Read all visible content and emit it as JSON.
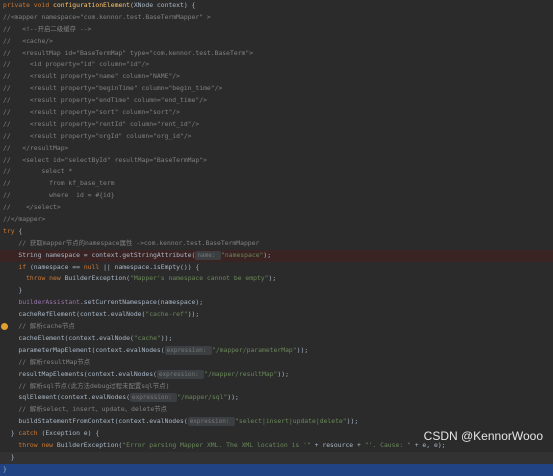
{
  "editor": {
    "lines": [
      {
        "kind": "plain",
        "segs": [
          {
            "t": "kw",
            "v": "private void "
          },
          {
            "t": "fn",
            "v": "configurationElement"
          },
          {
            "t": "plain",
            "v": "(XNode context) {"
          }
        ]
      },
      {
        "kind": "plain",
        "segs": [
          {
            "t": "cm",
            "v": "//<mapper namespace=\"com.kennor.test.BaseTermMapper\" >"
          }
        ]
      },
      {
        "kind": "plain",
        "segs": [
          {
            "t": "cm",
            "v": "//   <!--开启二级缓存 -->"
          }
        ]
      },
      {
        "kind": "plain",
        "segs": [
          {
            "t": "cm",
            "v": "//   <cache/>"
          }
        ]
      },
      {
        "kind": "plain",
        "segs": [
          {
            "t": "cm",
            "v": "//   <resultMap id=\"BaseTermMap\" type=\"com.kennor.test.BaseTerm\">"
          }
        ]
      },
      {
        "kind": "plain",
        "segs": [
          {
            "t": "cm",
            "v": "//     <id property=\"id\" column=\"id\"/>"
          }
        ]
      },
      {
        "kind": "plain",
        "segs": [
          {
            "t": "cm",
            "v": "//     <result property=\"name\" column=\"NAME\"/>"
          }
        ]
      },
      {
        "kind": "plain",
        "segs": [
          {
            "t": "cm",
            "v": "//     <result property=\"beginTime\" column=\"begin_time\"/>"
          }
        ]
      },
      {
        "kind": "plain",
        "segs": [
          {
            "t": "cm",
            "v": "//     <result property=\"endTime\" column=\"end_time\"/>"
          }
        ]
      },
      {
        "kind": "plain",
        "segs": [
          {
            "t": "cm",
            "v": "//     <result property=\"sort\" column=\"sort\"/>"
          }
        ]
      },
      {
        "kind": "plain",
        "segs": [
          {
            "t": "cm",
            "v": "//     <result property=\"rentId\" column=\"rent_id\"/>"
          }
        ]
      },
      {
        "kind": "plain",
        "segs": [
          {
            "t": "cm",
            "v": "//     <result property=\"orgId\" column=\"org_id\"/>"
          }
        ]
      },
      {
        "kind": "plain",
        "segs": [
          {
            "t": "cm",
            "v": "//   </resultMap>"
          }
        ]
      },
      {
        "kind": "plain",
        "segs": [
          {
            "t": "cm",
            "v": "//   <select id=\"selectById\" resultMap=\"BaseTermMap\">"
          }
        ]
      },
      {
        "kind": "plain",
        "segs": [
          {
            "t": "cm",
            "v": "//        select *"
          }
        ]
      },
      {
        "kind": "plain",
        "segs": [
          {
            "t": "cm",
            "v": "//          from kf_base_term"
          }
        ]
      },
      {
        "kind": "plain",
        "segs": [
          {
            "t": "cm",
            "v": "//          where  id = #{id}"
          }
        ]
      },
      {
        "kind": "plain",
        "segs": [
          {
            "t": "cm",
            "v": "//    </select>"
          }
        ]
      },
      {
        "kind": "plain",
        "segs": [
          {
            "t": "cm",
            "v": "//</mapper>"
          }
        ]
      },
      {
        "kind": "plain",
        "segs": [
          {
            "t": "kw",
            "v": "try "
          },
          {
            "t": "plain",
            "v": "{"
          }
        ]
      },
      {
        "kind": "plain",
        "segs": [
          {
            "t": "cm",
            "v": "    // 获取mapper节点的namespace属性 ->com.kennor.test.BaseTermMapper"
          }
        ]
      },
      {
        "kind": "hl",
        "segs": [
          {
            "t": "plain",
            "v": "    String namespace = context.getStringAttribute("
          },
          {
            "t": "hint",
            "v": "name: "
          },
          {
            "t": "str",
            "v": "\"namespace\""
          },
          {
            "t": "plain",
            "v": ");"
          }
        ]
      },
      {
        "kind": "plain",
        "segs": [
          {
            "t": "kw",
            "v": "    if "
          },
          {
            "t": "plain",
            "v": "(namespace == "
          },
          {
            "t": "kw",
            "v": "null "
          },
          {
            "t": "plain",
            "v": "|| namespace.isEmpty()) {"
          }
        ]
      },
      {
        "kind": "plain",
        "segs": [
          {
            "t": "kw",
            "v": "      throw new "
          },
          {
            "t": "plain",
            "v": "BuilderException("
          },
          {
            "t": "str",
            "v": "\"Mapper's namespace cannot be empty\""
          },
          {
            "t": "plain",
            "v": ");"
          }
        ]
      },
      {
        "kind": "plain",
        "segs": [
          {
            "t": "plain",
            "v": "    }"
          }
        ]
      },
      {
        "kind": "plain",
        "segs": [
          {
            "t": "field",
            "v": "    builderAssistant"
          },
          {
            "t": "plain",
            "v": ".setCurrentNamespace(namespace);"
          }
        ]
      },
      {
        "kind": "plain",
        "segs": [
          {
            "t": "plain",
            "v": "    cacheRefElement(context.evalNode("
          },
          {
            "t": "str",
            "v": "\"cache-ref\""
          },
          {
            "t": "plain",
            "v": "));"
          }
        ]
      },
      {
        "kind": "mark",
        "segs": [
          {
            "t": "cm",
            "v": "    // 解析cache节点"
          }
        ]
      },
      {
        "kind": "plain",
        "segs": [
          {
            "t": "plain",
            "v": "    cacheElement(context.evalNode("
          },
          {
            "t": "str",
            "v": "\"cache\""
          },
          {
            "t": "plain",
            "v": "));"
          }
        ]
      },
      {
        "kind": "plain",
        "segs": [
          {
            "t": "plain",
            "v": "    parameterMapElement(context.evalNodes("
          },
          {
            "t": "hint",
            "v": "expression: "
          },
          {
            "t": "str",
            "v": "\"/mapper/parameterMap\""
          },
          {
            "t": "plain",
            "v": "));"
          }
        ]
      },
      {
        "kind": "plain",
        "segs": [
          {
            "t": "cm",
            "v": "    // 解析resultMap节点"
          }
        ]
      },
      {
        "kind": "plain",
        "segs": [
          {
            "t": "plain",
            "v": "    resultMapElements(context.evalNodes("
          },
          {
            "t": "hint",
            "v": "expression: "
          },
          {
            "t": "str",
            "v": "\"/mapper/resultMap\""
          },
          {
            "t": "plain",
            "v": "));"
          }
        ]
      },
      {
        "kind": "plain",
        "segs": [
          {
            "t": "cm",
            "v": "    // 解析sql节点(此方法debug过程未配置sql节点)"
          }
        ]
      },
      {
        "kind": "plain",
        "segs": [
          {
            "t": "plain",
            "v": "    sqlElement(context.evalNodes("
          },
          {
            "t": "hint",
            "v": "expression: "
          },
          {
            "t": "str",
            "v": "\"/mapper/sql\""
          },
          {
            "t": "plain",
            "v": "));"
          }
        ]
      },
      {
        "kind": "plain",
        "segs": [
          {
            "t": "cm",
            "v": "    // 解析select、insert、update、delete节点"
          }
        ]
      },
      {
        "kind": "plain",
        "segs": [
          {
            "t": "plain",
            "v": "    buildStatementFromContext(context.evalNodes("
          },
          {
            "t": "hint",
            "v": "expression: "
          },
          {
            "t": "str",
            "v": "\"select|insert|update|delete\""
          },
          {
            "t": "plain",
            "v": "));"
          }
        ]
      },
      {
        "kind": "plain",
        "segs": [
          {
            "t": "plain",
            "v": "  } "
          },
          {
            "t": "kw",
            "v": "catch "
          },
          {
            "t": "plain",
            "v": "(Exception e) {"
          }
        ]
      },
      {
        "kind": "plain",
        "segs": [
          {
            "t": "kw",
            "v": "    throw new "
          },
          {
            "t": "plain",
            "v": "BuilderException("
          },
          {
            "t": "str",
            "v": "\"Error parsing Mapper XML. The XML location is '\" "
          },
          {
            "t": "plain",
            "v": "+ resource + "
          },
          {
            "t": "str",
            "v": "\"'. Cause: \" "
          },
          {
            "t": "plain",
            "v": "+ e, e);"
          }
        ]
      },
      {
        "kind": "cur",
        "segs": [
          {
            "t": "plain",
            "v": "  }"
          }
        ]
      },
      {
        "kind": "sel",
        "segs": [
          {
            "t": "plain",
            "v": "}"
          }
        ]
      }
    ]
  },
  "watermark": "CSDN @KennorWooo"
}
